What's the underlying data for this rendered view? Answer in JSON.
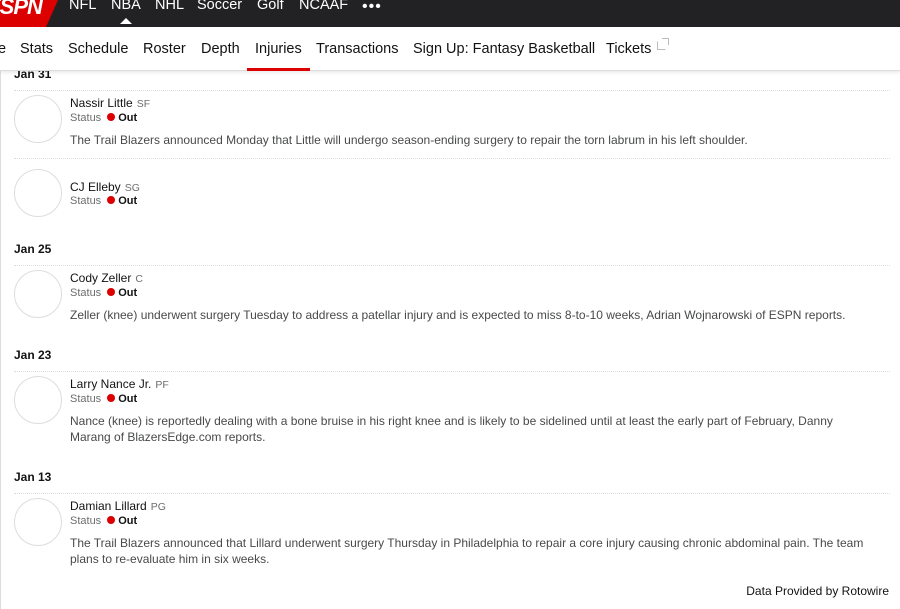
{
  "topnav": {
    "logo": "ESPN",
    "sports": [
      "NFL",
      "NBA",
      "NHL",
      "Soccer",
      "Golf",
      "NCAAF"
    ],
    "more": "•••"
  },
  "subnav": {
    "tabs": [
      "e",
      "Stats",
      "Schedule",
      "Roster",
      "Depth",
      "Injuries",
      "Transactions",
      "Sign Up: Fantasy Basketball",
      "Tickets"
    ],
    "active": "Injuries"
  },
  "injuries": {
    "dates": [
      "Jan 31",
      "Jan 25",
      "Jan 23",
      "Jan 13"
    ],
    "status_label": "Status",
    "status_color": "#dd0000",
    "players": [
      {
        "name": "Nassir Little",
        "pos": "SF",
        "status": "Out",
        "note": "The Trail Blazers announced Monday that Little will undergo season-ending surgery to repair the torn labrum in his left shoulder."
      },
      {
        "name": "CJ Elleby",
        "pos": "SG",
        "status": "Out",
        "note": ""
      },
      {
        "name": "Cody Zeller",
        "pos": "C",
        "status": "Out",
        "note": "Zeller (knee) underwent surgery Tuesday to address a patellar injury and is expected to miss 8-to-10 weeks, Adrian Wojnarowski of ESPN reports."
      },
      {
        "name": "Larry Nance Jr.",
        "pos": "PF",
        "status": "Out",
        "note": "Nance (knee) is reportedly dealing with a bone bruise in his right knee and is likely to be sidelined until at least the early part of February, Danny Marang of BlazersEdge.com reports."
      },
      {
        "name": "Damian Lillard",
        "pos": "PG",
        "status": "Out",
        "note": "The Trail Blazers announced that Lillard underwent surgery Thursday in Philadelphia to repair a core injury causing chronic abdominal pain. The team plans to re-evaluate him in six weeks."
      }
    ]
  },
  "footer": {
    "credit": "Data Provided by Rotowire"
  }
}
